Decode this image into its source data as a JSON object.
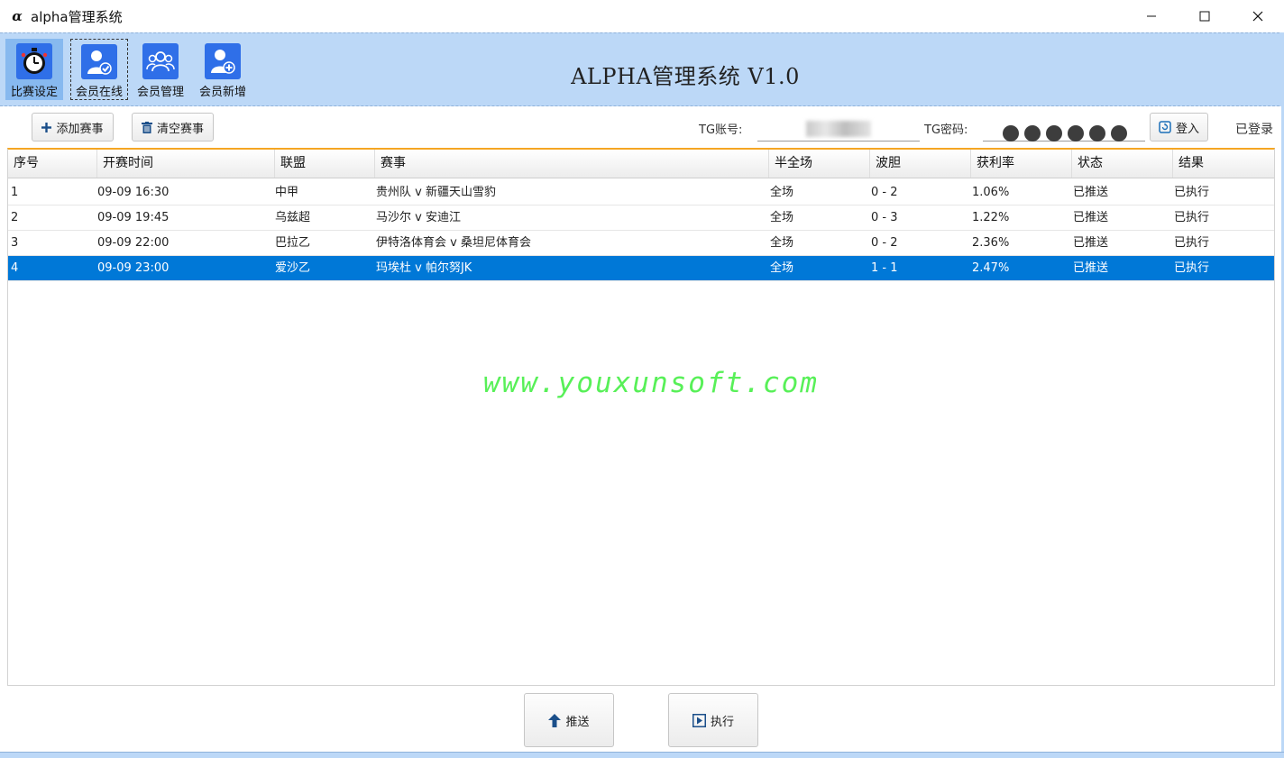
{
  "window": {
    "icon_glyph": "α",
    "title": "alpha管理系统",
    "controls": [
      "minimize",
      "maximize",
      "close"
    ]
  },
  "ribbon": {
    "heading": "ALPHA管理系统 V1.0",
    "buttons": [
      {
        "label": "比赛设定",
        "icon": "stopwatch-icon",
        "active": true
      },
      {
        "label": "会员在线",
        "icon": "user-check-icon",
        "focused": true
      },
      {
        "label": "会员管理",
        "icon": "users-group-icon"
      },
      {
        "label": "会员新增",
        "icon": "user-add-icon"
      }
    ],
    "background": "#bcd8f7"
  },
  "toolbar": {
    "add_match": "添加赛事",
    "clear_matches": "清空赛事",
    "tg_account_label": "TG账号:",
    "tg_password_label": "TG密码:",
    "login": "登入",
    "login_status": "已登录"
  },
  "table": {
    "columns": [
      "序号",
      "开赛时间",
      "联盟",
      "赛事",
      "半全场",
      "波胆",
      "获利率",
      "状态",
      "结果"
    ],
    "rows": [
      [
        "1",
        "09-09 16:30",
        "中甲",
        "贵州队 v 新疆天山雪豹",
        "全场",
        "0 - 2",
        "1.06%",
        "已推送",
        "已执行"
      ],
      [
        "2",
        "09-09 19:45",
        "乌兹超",
        "马沙尔 v 安迪江",
        "全场",
        "0 - 3",
        "1.22%",
        "已推送",
        "已执行"
      ],
      [
        "3",
        "09-09 22:00",
        "巴拉乙",
        "伊特洛体育会 v 桑坦尼体育会",
        "全场",
        "0 - 2",
        "2.36%",
        "已推送",
        "已执行"
      ],
      [
        "4",
        "09-09 23:00",
        "爱沙乙",
        "玛埃杜 v 帕尔努JK",
        "全场",
        "1 - 1",
        "2.47%",
        "已推送",
        "已执行"
      ]
    ],
    "selected_row": 4,
    "header_accent": "#f5a623",
    "selection_color": "#0078d7"
  },
  "watermark": "www.youxunsoft.com",
  "actions": {
    "push": "推送",
    "execute": "执行"
  }
}
